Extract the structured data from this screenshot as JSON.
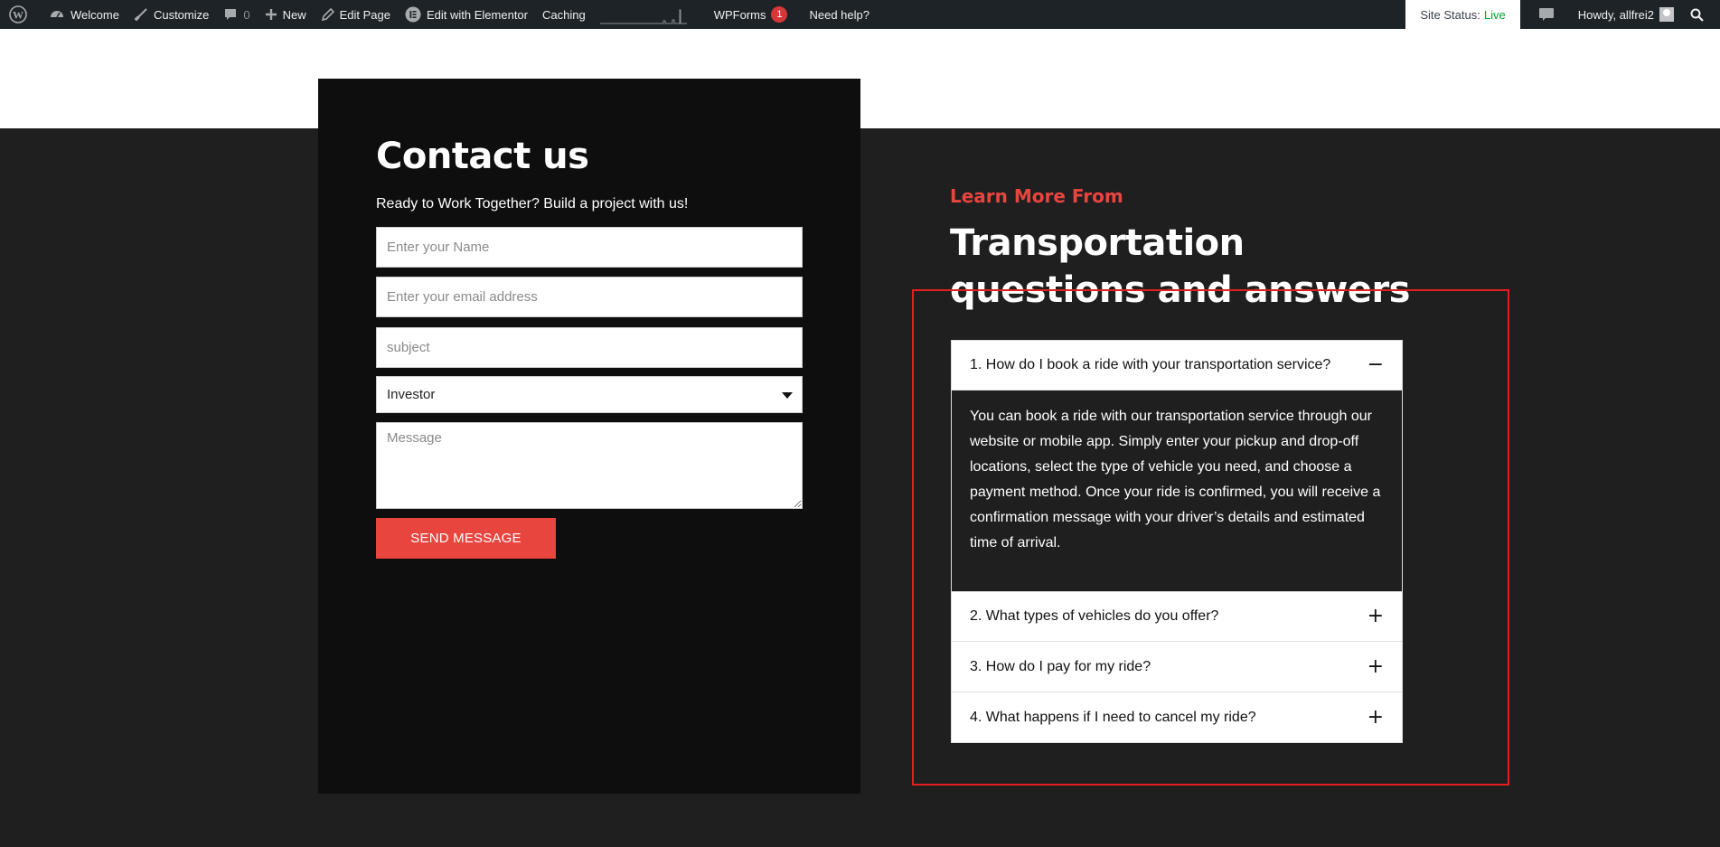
{
  "adminbar": {
    "items": [
      {
        "label": "Welcome",
        "icon": "dashboard-icon"
      },
      {
        "label": "Customize",
        "icon": "brush-icon"
      },
      {
        "label": "0",
        "icon": "comment-icon"
      },
      {
        "label": "New",
        "icon": "plus-icon"
      },
      {
        "label": "Edit Page",
        "icon": "pencil-icon"
      },
      {
        "label": "Edit with Elementor",
        "icon": "elementor-icon"
      },
      {
        "label": "Caching",
        "icon": ""
      }
    ],
    "wpforms_label": "WPForms",
    "wpforms_count": "1",
    "help_label": "Need help?",
    "site_status_label": "Site Status:",
    "site_status_value": "Live",
    "howdy": "Howdy, allfrei2"
  },
  "contact": {
    "title": "Contact us",
    "subtitle": "Ready to Work Together? Build a project with us!",
    "name_placeholder": "Enter your Name",
    "email_placeholder": "Enter your email address",
    "subject_placeholder": "subject",
    "role_value": "Investor",
    "message_placeholder": "Message",
    "send_label": "SEND MESSAGE"
  },
  "faq": {
    "eyebrow": "Learn More From",
    "title": "Transportation questions and answers",
    "items": [
      {
        "question": "1. How do I book a ride with your transportation service?",
        "icon": "−",
        "answer": "You can book a ride with our transportation service through our website or mobile app. Simply enter your pickup and drop-off locations, select the type of vehicle you need, and choose a payment method. Once your ride is confirmed, you will receive a confirmation message with your driver’s details and estimated time of arrival."
      },
      {
        "question": "2. What types of vehicles do you offer?",
        "icon": "+"
      },
      {
        "question": "3. How do I pay for my ride?",
        "icon": "+"
      },
      {
        "question": "4. What happens if I need to cancel my ride?",
        "icon": "+"
      }
    ]
  },
  "colors": {
    "accent": "#e8453f",
    "admin_bg": "#1d2327",
    "page_bg": "#1f1f1f",
    "panel_bg": "#0e0e0e",
    "highlight": "#e41f1f"
  }
}
